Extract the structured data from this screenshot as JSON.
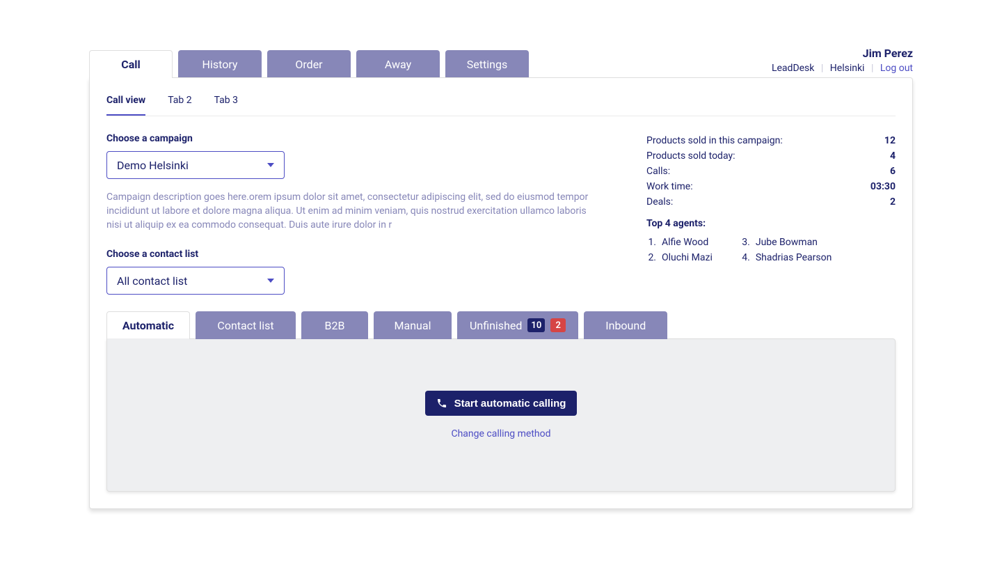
{
  "header": {
    "main_tabs": [
      "Call",
      "History",
      "Order",
      "Away",
      "Settings"
    ],
    "active_main_tab": 0,
    "user_name": "Jim Perez",
    "company": "LeadDesk",
    "location": "Helsinki",
    "logout": "Log out"
  },
  "subtabs": {
    "items": [
      "Call view",
      "Tab 2",
      "Tab 3"
    ],
    "active": 0
  },
  "campaign": {
    "choose_label": "Choose a campaign",
    "selected": "Demo Helsinki",
    "description": "Campaign description goes here.orem ipsum dolor sit amet, consectetur adipiscing elit, sed do eiusmod tempor incididunt ut labore et dolore magna aliqua. Ut enim ad minim veniam, quis nostrud exercitation ullamco laboris nisi ut aliquip ex ea commodo consequat. Duis aute irure dolor in r"
  },
  "contact_list": {
    "choose_label": "Choose a contact list",
    "selected": "All contact list"
  },
  "stats": {
    "campaign_sold_label": "Products sold in this campaign:",
    "campaign_sold_value": "12",
    "today_sold_label": "Products sold today:",
    "today_sold_value": "4",
    "calls_label": "Calls:",
    "calls_value": "6",
    "work_time_label": "Work time:",
    "work_time_value": "03:30",
    "deals_label": "Deals:",
    "deals_value": "2",
    "top_agents_label": "Top 4 agents:",
    "agents": [
      "Alfie Wood",
      "Oluchi Mazi",
      "Jube Bowman",
      "Shadrias Pearson"
    ]
  },
  "modes": {
    "items": [
      "Automatic",
      "Contact list",
      "B2B",
      "Manual",
      "Unfinished",
      "Inbound"
    ],
    "active": 0,
    "unfinished_badges": {
      "primary": "10",
      "secondary": "2"
    }
  },
  "call_area": {
    "start_button": "Start automatic calling",
    "change_method": "Change calling method"
  }
}
